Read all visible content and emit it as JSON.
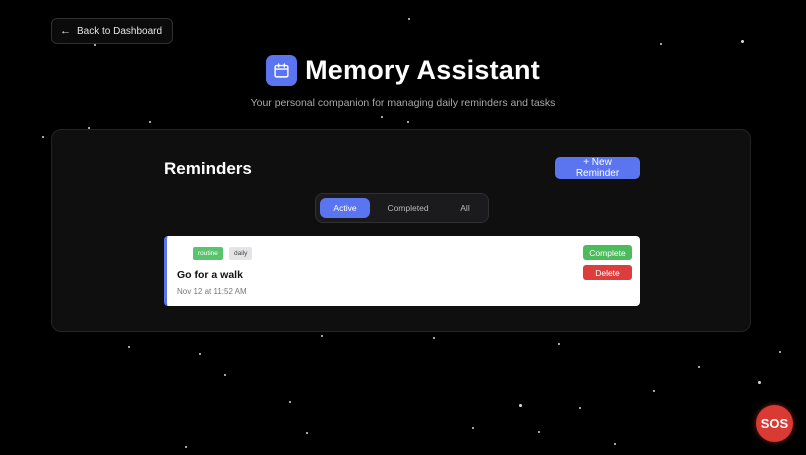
{
  "header": {
    "back_label": "Back to Dashboard",
    "title": "Memory Assistant",
    "subtitle": "Your personal companion for managing daily reminders and tasks"
  },
  "reminders": {
    "section_title": "Reminders",
    "new_button": "+ New Reminder",
    "tabs": [
      {
        "label": "Active",
        "active": true
      },
      {
        "label": "Completed",
        "active": false
      },
      {
        "label": "All",
        "active": false
      }
    ],
    "items": [
      {
        "tags": [
          "routine",
          "daily"
        ],
        "title": "Go for a walk",
        "time": "Nov 12 at 11:52 AM",
        "complete_label": "Complete",
        "delete_label": "Delete"
      }
    ]
  },
  "sos_label": "SOS",
  "colors": {
    "accent": "#5b74f0",
    "complete": "#4cbb5c",
    "delete": "#dc3e3e",
    "sos": "#d93a33",
    "tag_routine": "#58c46d"
  },
  "icons": {
    "back": "arrow-left-icon",
    "title": "calendar-icon"
  }
}
